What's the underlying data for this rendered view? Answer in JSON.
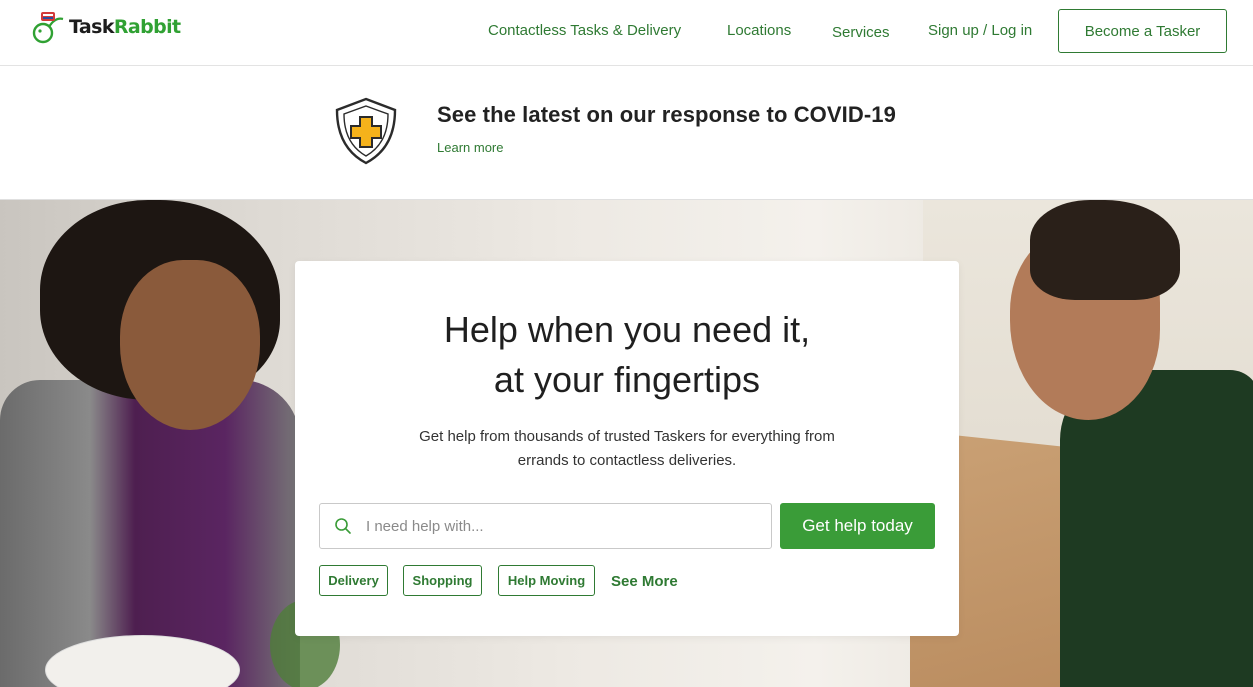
{
  "header": {
    "logo_word_a": "Task",
    "logo_word_b": "Rabbit",
    "nav": [
      {
        "label": "Contactless Tasks & Delivery"
      },
      {
        "label": "Locations"
      },
      {
        "label": "Services"
      },
      {
        "label": "Sign up / Log in"
      }
    ],
    "become_tasker": "Become a Tasker"
  },
  "covid": {
    "title": "See the latest on our response to COVID-19",
    "link": "Learn more"
  },
  "hero": {
    "headline_line1": "Help when you need it,",
    "headline_line2": "at your fingertips",
    "sub_line1": "Get help from thousands of trusted Taskers for everything from",
    "sub_line2": "errands to contactless deliveries.",
    "search_placeholder": "I need help with...",
    "cta": "Get help today",
    "chips": [
      {
        "label": "Delivery"
      },
      {
        "label": "Shopping"
      },
      {
        "label": "Help Moving"
      }
    ],
    "see_more": "See More"
  },
  "colors": {
    "brand_green": "#3a9c38",
    "link_green": "#2f7a33",
    "shield_yellow": "#f5b21b"
  }
}
